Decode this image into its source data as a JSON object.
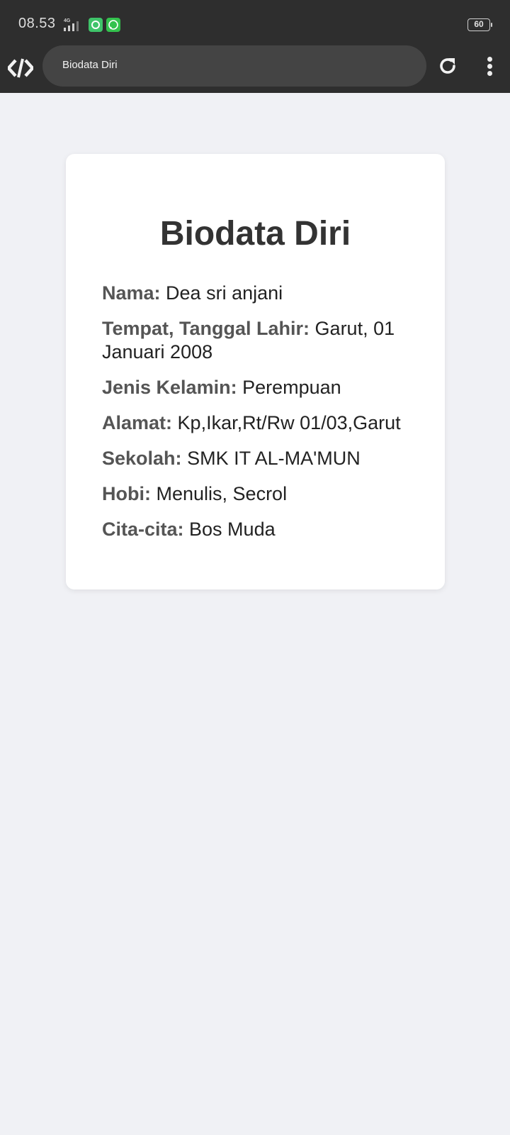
{
  "status_bar": {
    "time": "08.53",
    "network": "4G",
    "battery": "60",
    "notification_icons": [
      "app-notification-icon",
      "whatsapp-icon"
    ]
  },
  "browser": {
    "url_text": "Biodata Diri",
    "logo_icon": "code-logo-icon",
    "reload_icon": "reload-icon",
    "menu_icon": "more-vert-icon"
  },
  "card": {
    "title": "Biodata Diri",
    "fields": [
      {
        "label": "Nama:",
        "value": "Dea sri anjani"
      },
      {
        "label": "Tempat, Tanggal Lahir:",
        "value": "Garut, 01 Januari 2008"
      },
      {
        "label": "Jenis Kelamin:",
        "value": "Perempuan"
      },
      {
        "label": "Alamat:",
        "value": "Kp,Ikar,Rt/Rw 01/03,Garut"
      },
      {
        "label": "Sekolah:",
        "value": "SMK IT AL-MA'MUN"
      },
      {
        "label": "Hobi:",
        "value": "Menulis, Secrol"
      },
      {
        "label": "Cita-cita:",
        "value": "Bos Muda"
      }
    ]
  },
  "colors": {
    "page_background": "#f0f1f5",
    "bar_background": "#2e2e2e",
    "card_background": "#ffffff",
    "title_color": "#333333",
    "label_color": "#555555"
  }
}
